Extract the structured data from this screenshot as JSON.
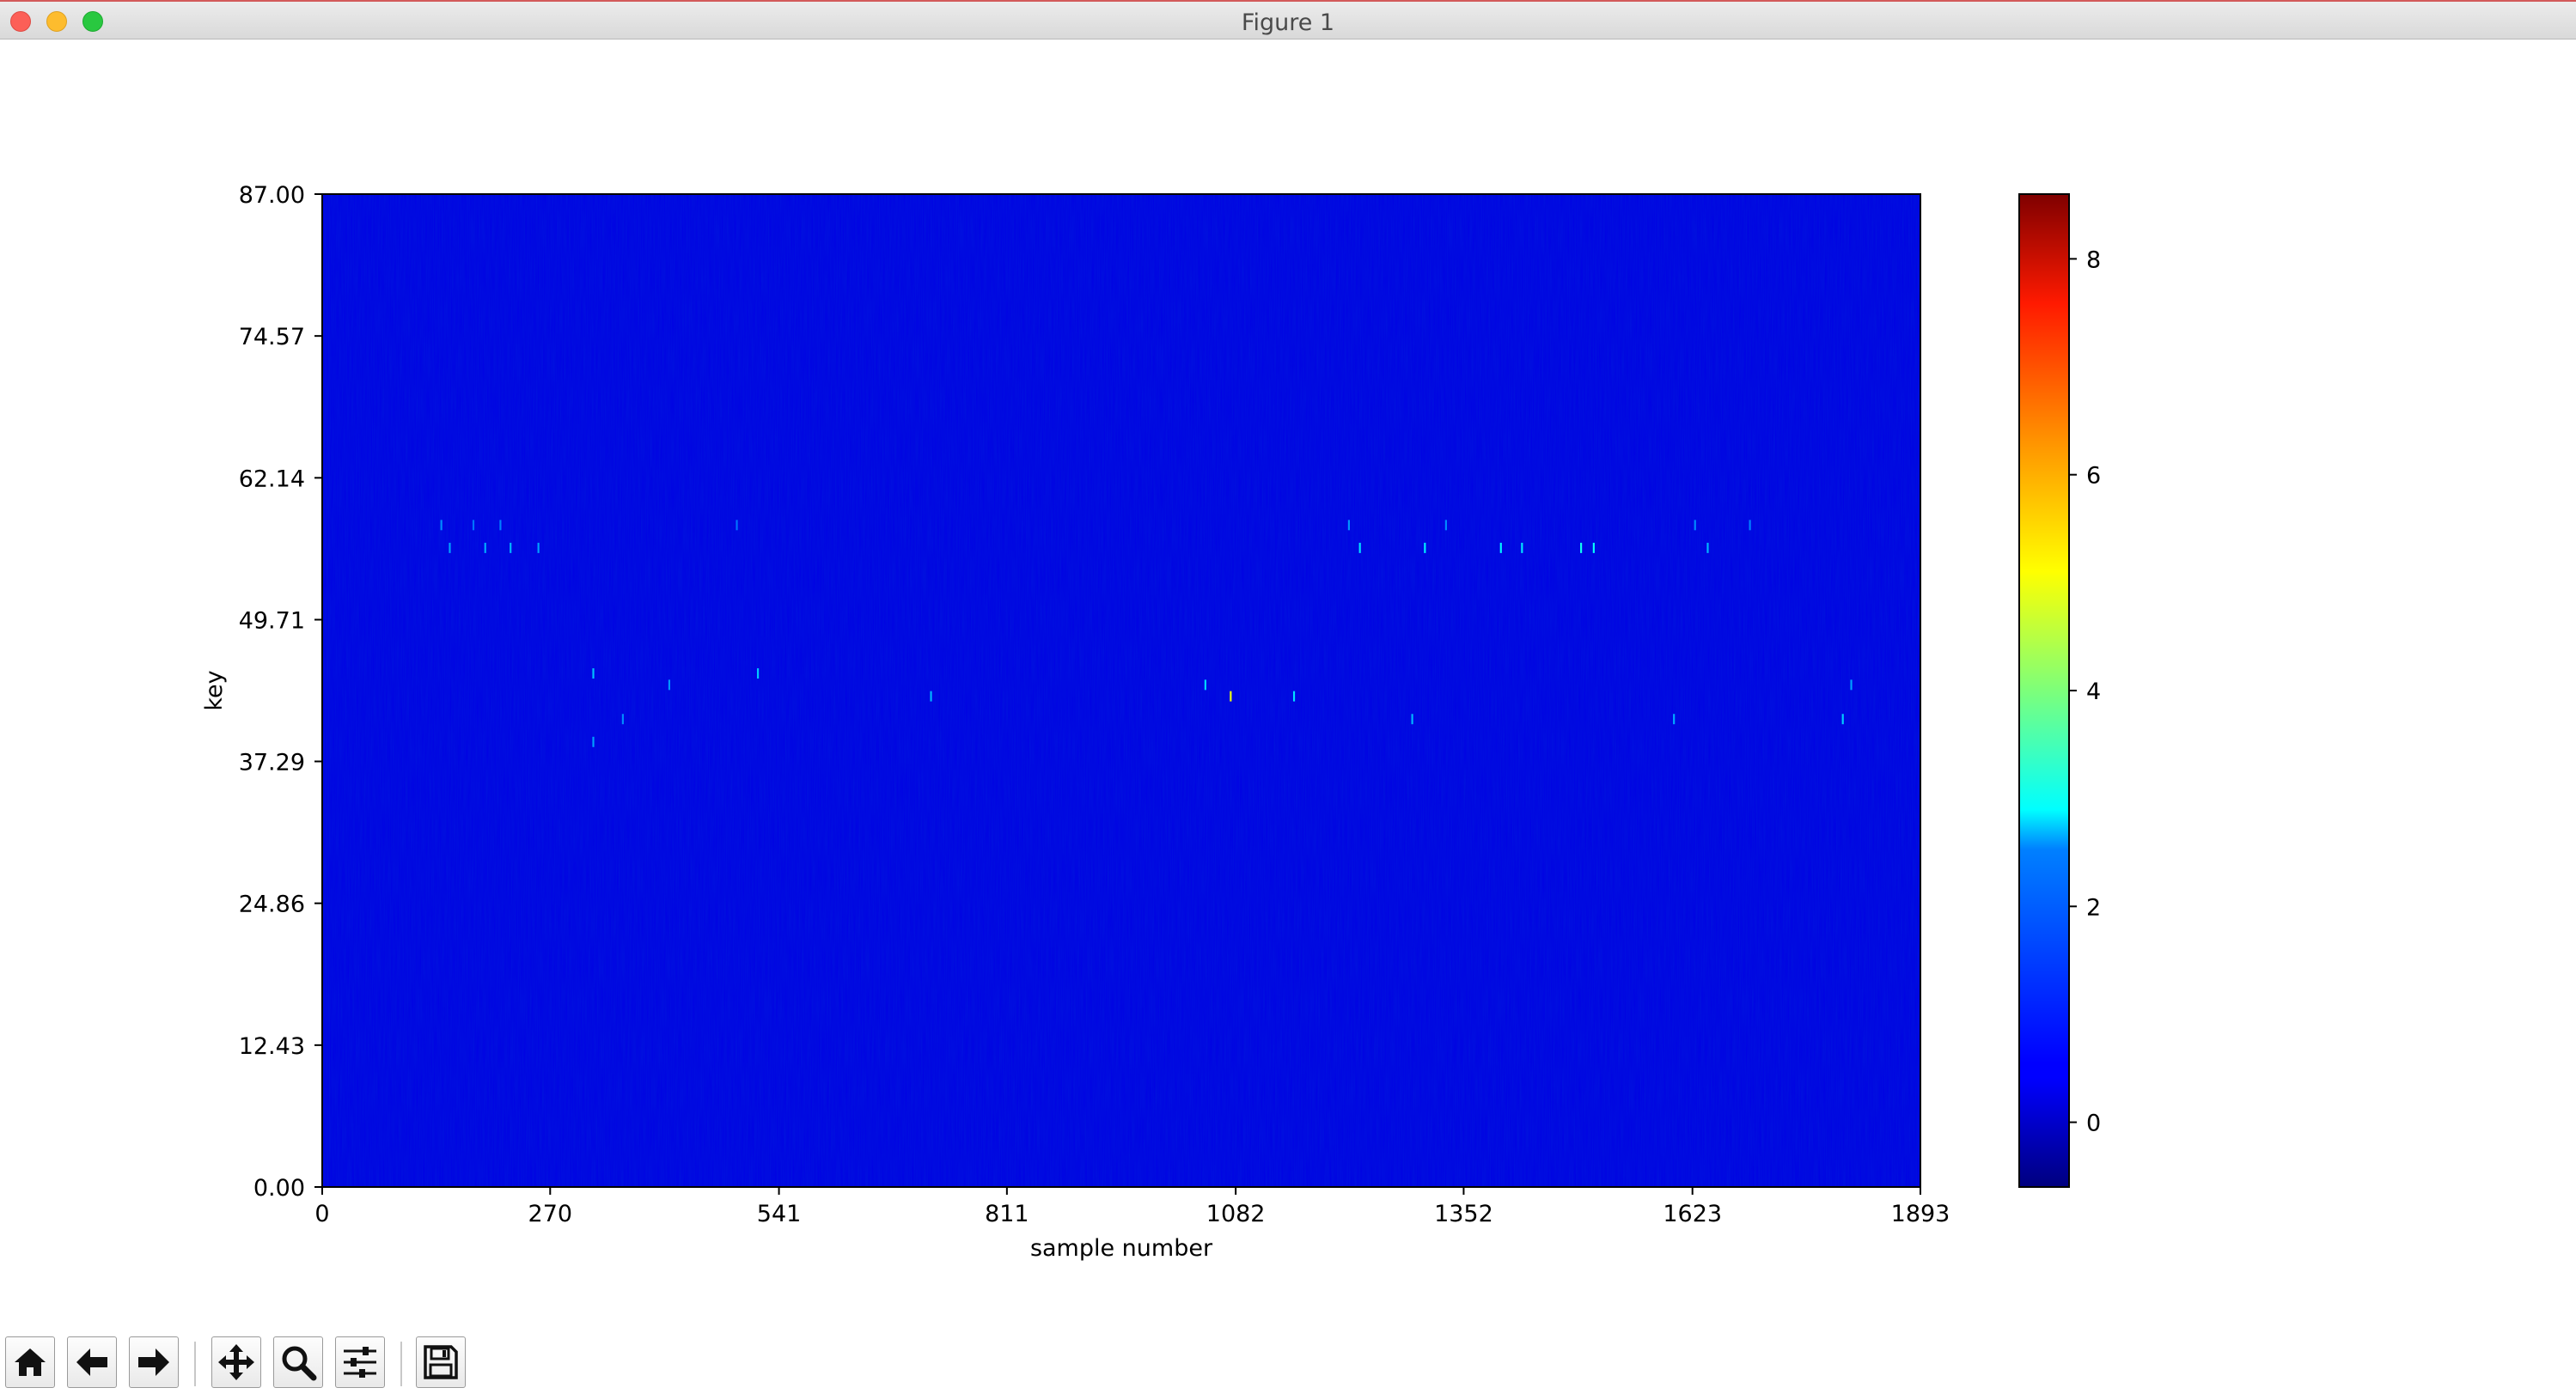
{
  "window": {
    "title": "Figure 1"
  },
  "toolbar": {
    "buttons": [
      {
        "name": "home-button",
        "icon": "home-icon"
      },
      {
        "name": "back-button",
        "icon": "arrow-left-icon"
      },
      {
        "name": "forward-button",
        "icon": "arrow-right-icon"
      },
      {
        "name": "pan-button",
        "icon": "move-icon"
      },
      {
        "name": "zoom-button",
        "icon": "magnifier-icon"
      },
      {
        "name": "configure-subplots-button",
        "icon": "sliders-icon"
      },
      {
        "name": "save-button",
        "icon": "floppy-disk-icon"
      }
    ]
  },
  "chart_data": {
    "type": "heatmap",
    "title": "",
    "xlabel": "sample number",
    "ylabel": "key",
    "xlim": [
      0,
      1893
    ],
    "ylim": [
      0,
      87
    ],
    "x_ticks": [
      "0",
      "270",
      "541",
      "811",
      "1082",
      "1352",
      "1623",
      "1893"
    ],
    "x_tick_values": [
      0,
      270,
      541,
      811,
      1082,
      1352,
      1623,
      1893
    ],
    "y_ticks": [
      "0.00",
      "12.43",
      "24.86",
      "37.29",
      "49.71",
      "62.14",
      "74.57",
      "87.00"
    ],
    "y_tick_values": [
      0,
      12.43,
      24.86,
      37.29,
      49.71,
      62.14,
      74.57,
      87
    ],
    "colormap": "jet",
    "colorbar": {
      "min": -0.6,
      "max": 8.6,
      "ticks": [
        0,
        2,
        4,
        6,
        8
      ],
      "tick_labels": [
        "0",
        "2",
        "4",
        "6",
        "8"
      ]
    },
    "background_value": 0.3,
    "highlights": [
      {
        "x": 140,
        "y": 58,
        "value": 1.8
      },
      {
        "x": 150,
        "y": 56,
        "value": 2.0
      },
      {
        "x": 178,
        "y": 58,
        "value": 1.6
      },
      {
        "x": 192,
        "y": 56,
        "value": 2.1
      },
      {
        "x": 210,
        "y": 58,
        "value": 1.7
      },
      {
        "x": 222,
        "y": 56,
        "value": 2.2
      },
      {
        "x": 255,
        "y": 56,
        "value": 2.0
      },
      {
        "x": 490,
        "y": 58,
        "value": 1.6
      },
      {
        "x": 1215,
        "y": 58,
        "value": 1.9
      },
      {
        "x": 1228,
        "y": 56,
        "value": 2.6
      },
      {
        "x": 1305,
        "y": 56,
        "value": 2.7
      },
      {
        "x": 1330,
        "y": 58,
        "value": 1.8
      },
      {
        "x": 1395,
        "y": 56,
        "value": 2.8
      },
      {
        "x": 1420,
        "y": 56,
        "value": 2.6
      },
      {
        "x": 1490,
        "y": 56,
        "value": 3.0
      },
      {
        "x": 1505,
        "y": 56,
        "value": 2.9
      },
      {
        "x": 1625,
        "y": 58,
        "value": 1.8
      },
      {
        "x": 1640,
        "y": 56,
        "value": 2.2
      },
      {
        "x": 1690,
        "y": 58,
        "value": 1.7
      },
      {
        "x": 320,
        "y": 45,
        "value": 2.3
      },
      {
        "x": 410,
        "y": 44,
        "value": 1.9
      },
      {
        "x": 515,
        "y": 45,
        "value": 2.4
      },
      {
        "x": 720,
        "y": 43,
        "value": 2.2
      },
      {
        "x": 1045,
        "y": 44,
        "value": 2.5
      },
      {
        "x": 1075,
        "y": 43,
        "value": 5.0
      },
      {
        "x": 1150,
        "y": 43,
        "value": 2.6
      },
      {
        "x": 1290,
        "y": 41,
        "value": 2.2
      },
      {
        "x": 1810,
        "y": 44,
        "value": 2.0
      },
      {
        "x": 320,
        "y": 39,
        "value": 2.0
      },
      {
        "x": 355,
        "y": 41,
        "value": 1.8
      },
      {
        "x": 1600,
        "y": 41,
        "value": 2.1
      },
      {
        "x": 1800,
        "y": 41,
        "value": 2.4
      }
    ]
  }
}
